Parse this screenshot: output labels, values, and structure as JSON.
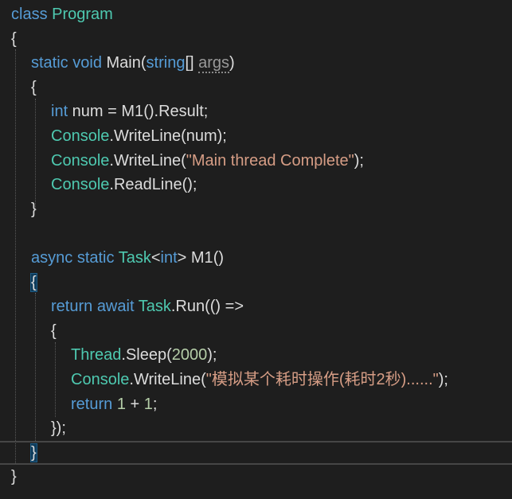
{
  "editor": {
    "lines": [
      {
        "id": "class-decl",
        "indent": 0,
        "tokens": [
          {
            "t": "class",
            "c": "kw"
          },
          {
            "t": " ",
            "c": "plain"
          },
          {
            "t": "Program",
            "c": "type"
          }
        ]
      },
      {
        "id": "class-open",
        "indent": 0,
        "tokens": [
          {
            "t": "{",
            "c": "plain"
          }
        ]
      },
      {
        "id": "main-decl",
        "indent": 1,
        "tokens": [
          {
            "t": "static",
            "c": "kw"
          },
          {
            "t": " ",
            "c": "plain"
          },
          {
            "t": "void",
            "c": "kw"
          },
          {
            "t": " ",
            "c": "plain"
          },
          {
            "t": "Main",
            "c": "method"
          },
          {
            "t": "(",
            "c": "plain"
          },
          {
            "t": "string",
            "c": "kw"
          },
          {
            "t": "[] ",
            "c": "plain"
          },
          {
            "t": "args",
            "c": "param",
            "squiggle": true
          },
          {
            "t": ")",
            "c": "plain"
          }
        ]
      },
      {
        "id": "main-open",
        "indent": 1,
        "tokens": [
          {
            "t": "{",
            "c": "plain"
          }
        ]
      },
      {
        "id": "main-l1",
        "indent": 2,
        "tokens": [
          {
            "t": "int",
            "c": "kw"
          },
          {
            "t": " num = ",
            "c": "plain"
          },
          {
            "t": "M1",
            "c": "method"
          },
          {
            "t": "().",
            "c": "plain"
          },
          {
            "t": "Result",
            "c": "plain"
          },
          {
            "t": ";",
            "c": "plain"
          }
        ]
      },
      {
        "id": "main-l2",
        "indent": 2,
        "tokens": [
          {
            "t": "Console",
            "c": "type"
          },
          {
            "t": ".",
            "c": "plain"
          },
          {
            "t": "WriteLine",
            "c": "method"
          },
          {
            "t": "(num);",
            "c": "plain"
          }
        ]
      },
      {
        "id": "main-l3",
        "indent": 2,
        "tokens": [
          {
            "t": "Console",
            "c": "type"
          },
          {
            "t": ".",
            "c": "plain"
          },
          {
            "t": "WriteLine",
            "c": "method"
          },
          {
            "t": "(",
            "c": "plain"
          },
          {
            "t": "\"Main thread Complete\"",
            "c": "str"
          },
          {
            "t": ");",
            "c": "plain"
          }
        ]
      },
      {
        "id": "main-l4",
        "indent": 2,
        "tokens": [
          {
            "t": "Console",
            "c": "type"
          },
          {
            "t": ".",
            "c": "plain"
          },
          {
            "t": "ReadLine",
            "c": "method"
          },
          {
            "t": "();",
            "c": "plain"
          }
        ]
      },
      {
        "id": "main-close",
        "indent": 1,
        "tokens": [
          {
            "t": "}",
            "c": "plain"
          }
        ]
      },
      {
        "id": "blank",
        "indent": 0,
        "tokens": []
      },
      {
        "id": "m1-decl",
        "indent": 1,
        "tokens": [
          {
            "t": "async",
            "c": "kw"
          },
          {
            "t": " ",
            "c": "plain"
          },
          {
            "t": "static",
            "c": "kw"
          },
          {
            "t": " ",
            "c": "plain"
          },
          {
            "t": "Task",
            "c": "type"
          },
          {
            "t": "<",
            "c": "plain"
          },
          {
            "t": "int",
            "c": "kw"
          },
          {
            "t": "> ",
            "c": "plain"
          },
          {
            "t": "M1",
            "c": "method"
          },
          {
            "t": "()",
            "c": "plain"
          }
        ]
      },
      {
        "id": "m1-open",
        "indent": 1,
        "tokens": [
          {
            "t": "{",
            "c": "plain",
            "highlight": true
          }
        ]
      },
      {
        "id": "m1-return",
        "indent": 2,
        "tokens": [
          {
            "t": "return",
            "c": "kw"
          },
          {
            "t": " ",
            "c": "plain"
          },
          {
            "t": "await",
            "c": "kw"
          },
          {
            "t": " ",
            "c": "plain"
          },
          {
            "t": "Task",
            "c": "type"
          },
          {
            "t": ".",
            "c": "plain"
          },
          {
            "t": "Run",
            "c": "method"
          },
          {
            "t": "(() =>",
            "c": "plain"
          }
        ]
      },
      {
        "id": "lambda-open",
        "indent": 2,
        "tokens": [
          {
            "t": "{",
            "c": "plain"
          }
        ]
      },
      {
        "id": "lambda-l1",
        "indent": 3,
        "tokens": [
          {
            "t": "Thread",
            "c": "type"
          },
          {
            "t": ".",
            "c": "plain"
          },
          {
            "t": "Sleep",
            "c": "method"
          },
          {
            "t": "(",
            "c": "plain"
          },
          {
            "t": "2000",
            "c": "num"
          },
          {
            "t": ");",
            "c": "plain"
          }
        ]
      },
      {
        "id": "lambda-l2",
        "indent": 3,
        "tokens": [
          {
            "t": "Console",
            "c": "type"
          },
          {
            "t": ".",
            "c": "plain"
          },
          {
            "t": "WriteLine",
            "c": "method"
          },
          {
            "t": "(",
            "c": "plain"
          },
          {
            "t": "\"模拟某个耗时操作(耗时2秒)......\"",
            "c": "str"
          },
          {
            "t": ");",
            "c": "plain"
          }
        ]
      },
      {
        "id": "lambda-l3",
        "indent": 3,
        "tokens": [
          {
            "t": "return",
            "c": "kw"
          },
          {
            "t": " ",
            "c": "plain"
          },
          {
            "t": "1",
            "c": "num"
          },
          {
            "t": " + ",
            "c": "plain"
          },
          {
            "t": "1",
            "c": "num"
          },
          {
            "t": ";",
            "c": "plain"
          }
        ]
      },
      {
        "id": "lambda-close",
        "indent": 2,
        "tokens": [
          {
            "t": "});",
            "c": "plain"
          }
        ]
      },
      {
        "id": "m1-close",
        "indent": 1,
        "current": true,
        "tokens": [
          {
            "t": "}",
            "c": "plain",
            "highlight": true
          }
        ]
      },
      {
        "id": "class-close",
        "indent": 0,
        "tokens": [
          {
            "t": "}",
            "c": "plain"
          }
        ]
      }
    ]
  },
  "colors": {
    "background": "#1e1e1e",
    "keyword": "#569cd6",
    "type": "#4ec9b0",
    "string": "#d69d85",
    "number": "#b5cea8",
    "text": "#dcdcdc"
  }
}
